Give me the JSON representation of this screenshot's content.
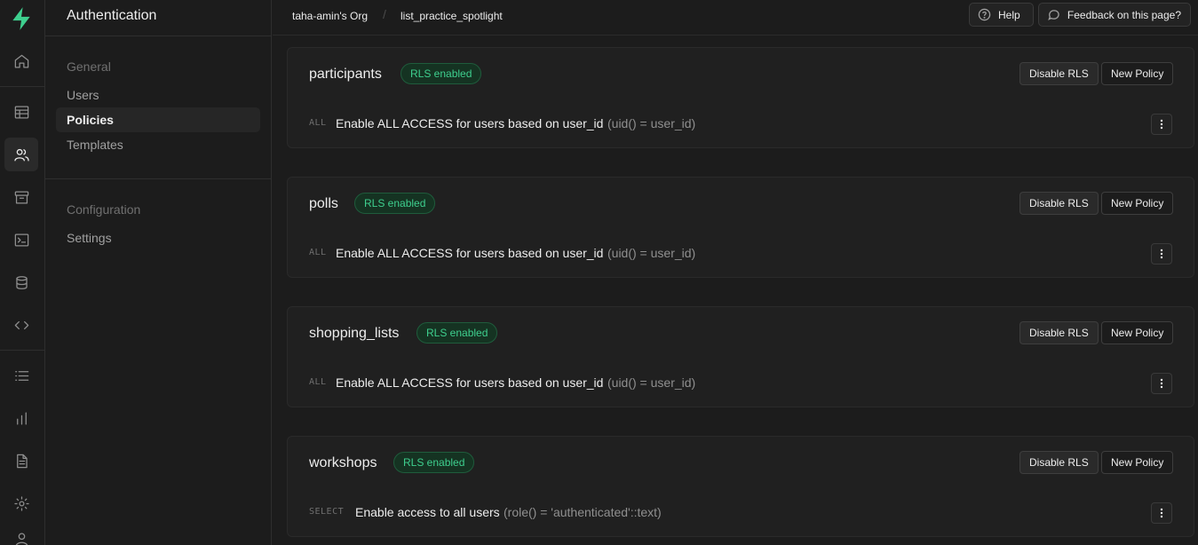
{
  "sidebar": {
    "title": "Authentication",
    "sections": [
      {
        "label": "General",
        "items": [
          "Users",
          "Policies",
          "Templates"
        ]
      },
      {
        "label": "Configuration",
        "items": [
          "Settings"
        ]
      }
    ]
  },
  "breadcrumb": {
    "org": "taha-amin's Org",
    "project": "list_practice_spotlight"
  },
  "header": {
    "help_label": "Help",
    "feedback_label": "Feedback on this page?"
  },
  "tables": [
    {
      "name": "participants",
      "badge": "RLS enabled",
      "disable_label": "Disable RLS",
      "new_policy_label": "New Policy",
      "policy": {
        "command": "ALL",
        "name": "Enable ALL ACCESS for users based on user_id",
        "definition": "(uid() = user_id)"
      }
    },
    {
      "name": "polls",
      "badge": "RLS enabled",
      "disable_label": "Disable RLS",
      "new_policy_label": "New Policy",
      "policy": {
        "command": "ALL",
        "name": "Enable ALL ACCESS for users based on user_id",
        "definition": "(uid() = user_id)"
      }
    },
    {
      "name": "shopping_lists",
      "badge": "RLS enabled",
      "disable_label": "Disable RLS",
      "new_policy_label": "New Policy",
      "policy": {
        "command": "ALL",
        "name": "Enable ALL ACCESS for users based on user_id",
        "definition": "(uid() = user_id)"
      }
    },
    {
      "name": "workshops",
      "badge": "RLS enabled",
      "disable_label": "Disable RLS",
      "new_policy_label": "New Policy",
      "policy": {
        "command": "SELECT",
        "name": "Enable access to all users",
        "definition": "(role() = 'authenticated'::text)"
      }
    }
  ],
  "colors": {
    "accent": "#3ecf8e",
    "background": "#1c1c1c",
    "card": "#202020"
  }
}
